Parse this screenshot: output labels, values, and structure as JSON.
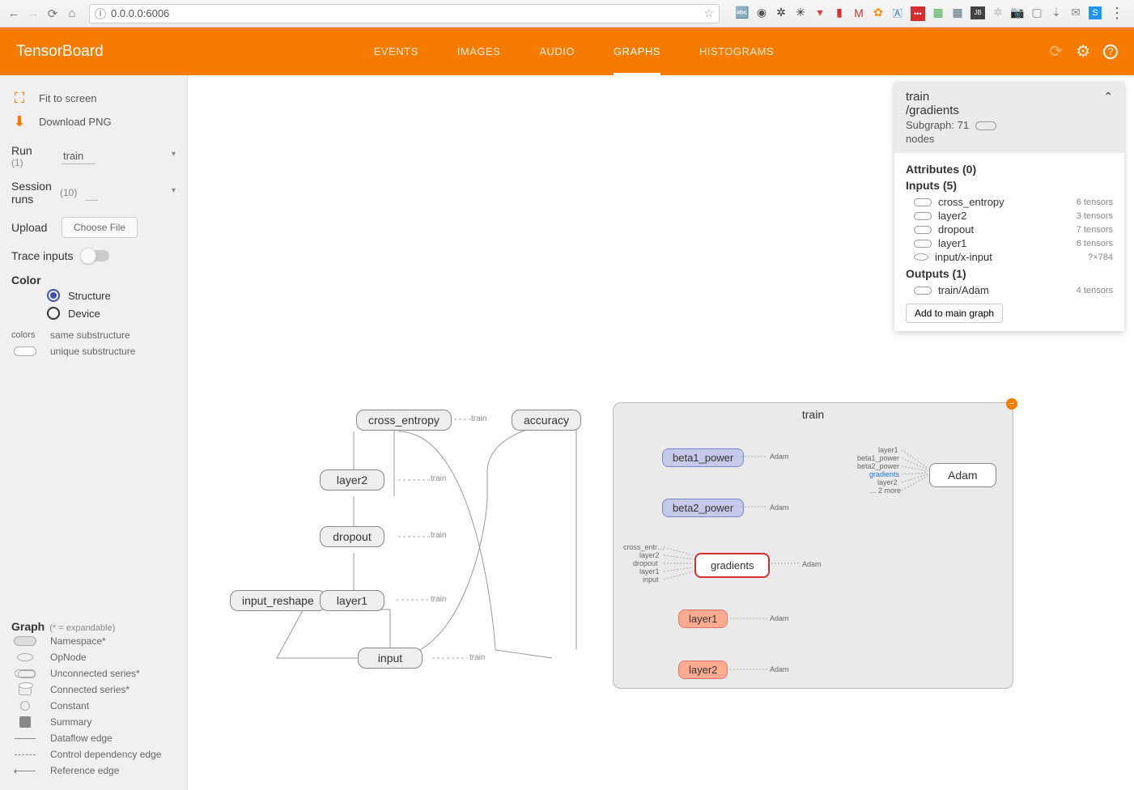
{
  "browser": {
    "url": "0.0.0.0:6006",
    "ext_icons": [
      "🔤",
      "⊙",
      "✱",
      "✶",
      "🗂",
      "📕",
      "M",
      "🔅",
      "🇦",
      "⋯",
      "📅",
      "🖼",
      "JB",
      "✳",
      "📷",
      "📋",
      "⬇",
      "✉",
      "S"
    ]
  },
  "header": {
    "logo": "TensorBoard",
    "tabs": [
      "EVENTS",
      "IMAGES",
      "AUDIO",
      "GRAPHS",
      "HISTOGRAMS"
    ],
    "active_tab": 3
  },
  "sidebar": {
    "fit": "Fit to screen",
    "download": "Download PNG",
    "run_label": "Run",
    "run_count": "(1)",
    "run_value": "train",
    "session_label": "Session runs",
    "session_count": "(10)",
    "upload_label": "Upload",
    "choose_file": "Choose File",
    "trace_label": "Trace inputs",
    "color_label": "Color",
    "color_options": [
      "Structure",
      "Device"
    ],
    "colors_label": "colors",
    "colors_items": [
      "same substructure",
      "unique substructure"
    ],
    "graph_label": "Graph",
    "graph_sub": "(* = expandable)",
    "legend": [
      {
        "sym": "ns",
        "label": "Namespace*"
      },
      {
        "sym": "op",
        "label": "OpNode"
      },
      {
        "sym": "us",
        "label": "Unconnected series*"
      },
      {
        "sym": "cs",
        "label": "Connected series*"
      },
      {
        "sym": "const",
        "label": "Constant"
      },
      {
        "sym": "sum",
        "label": "Summary"
      },
      {
        "sym": "df",
        "label": "Dataflow edge"
      },
      {
        "sym": "cd",
        "label": "Control dependency edge"
      },
      {
        "sym": "ref",
        "label": "Reference edge"
      }
    ]
  },
  "graph": {
    "left_nodes": {
      "cross_entropy": "cross_entropy",
      "accuracy": "accuracy",
      "layer2": "layer2",
      "dropout": "dropout",
      "input_reshape": "input_reshape",
      "layer1": "layer1",
      "input": "input",
      "train_label": "train"
    },
    "subgraph": {
      "title": "train",
      "nodes": {
        "beta1": "beta1_power",
        "beta2": "beta2_power",
        "gradients": "gradients",
        "layer1": "layer1",
        "layer2": "layer2",
        "adam": "Adam"
      },
      "adam_label": "Adam",
      "grad_inputs": [
        "cross_entr…",
        "layer2",
        "dropout",
        "layer1",
        "input"
      ],
      "adam_inputs": [
        "layer1",
        "beta1_power",
        "beta2_power",
        "gradients",
        "layer2",
        "... 2 more"
      ]
    }
  },
  "info": {
    "title1": "train",
    "title2": "/gradients",
    "subgraph_label": "Subgraph: 71",
    "nodes_label": "nodes",
    "attributes": "Attributes (0)",
    "inputs_label": "Inputs (5)",
    "inputs": [
      {
        "name": "cross_entropy",
        "meta": "6 tensors",
        "shape": "pill"
      },
      {
        "name": "layer2",
        "meta": "3 tensors",
        "shape": "pill"
      },
      {
        "name": "dropout",
        "meta": "7 tensors",
        "shape": "pill"
      },
      {
        "name": "layer1",
        "meta": "6 tensors",
        "shape": "pill"
      },
      {
        "name": "input/x-input",
        "meta": "?×784",
        "shape": "ellipse"
      }
    ],
    "outputs_label": "Outputs (1)",
    "outputs": [
      {
        "name": "train/Adam",
        "meta": "4 tensors",
        "shape": "pill"
      }
    ],
    "add_btn": "Add to main graph"
  }
}
